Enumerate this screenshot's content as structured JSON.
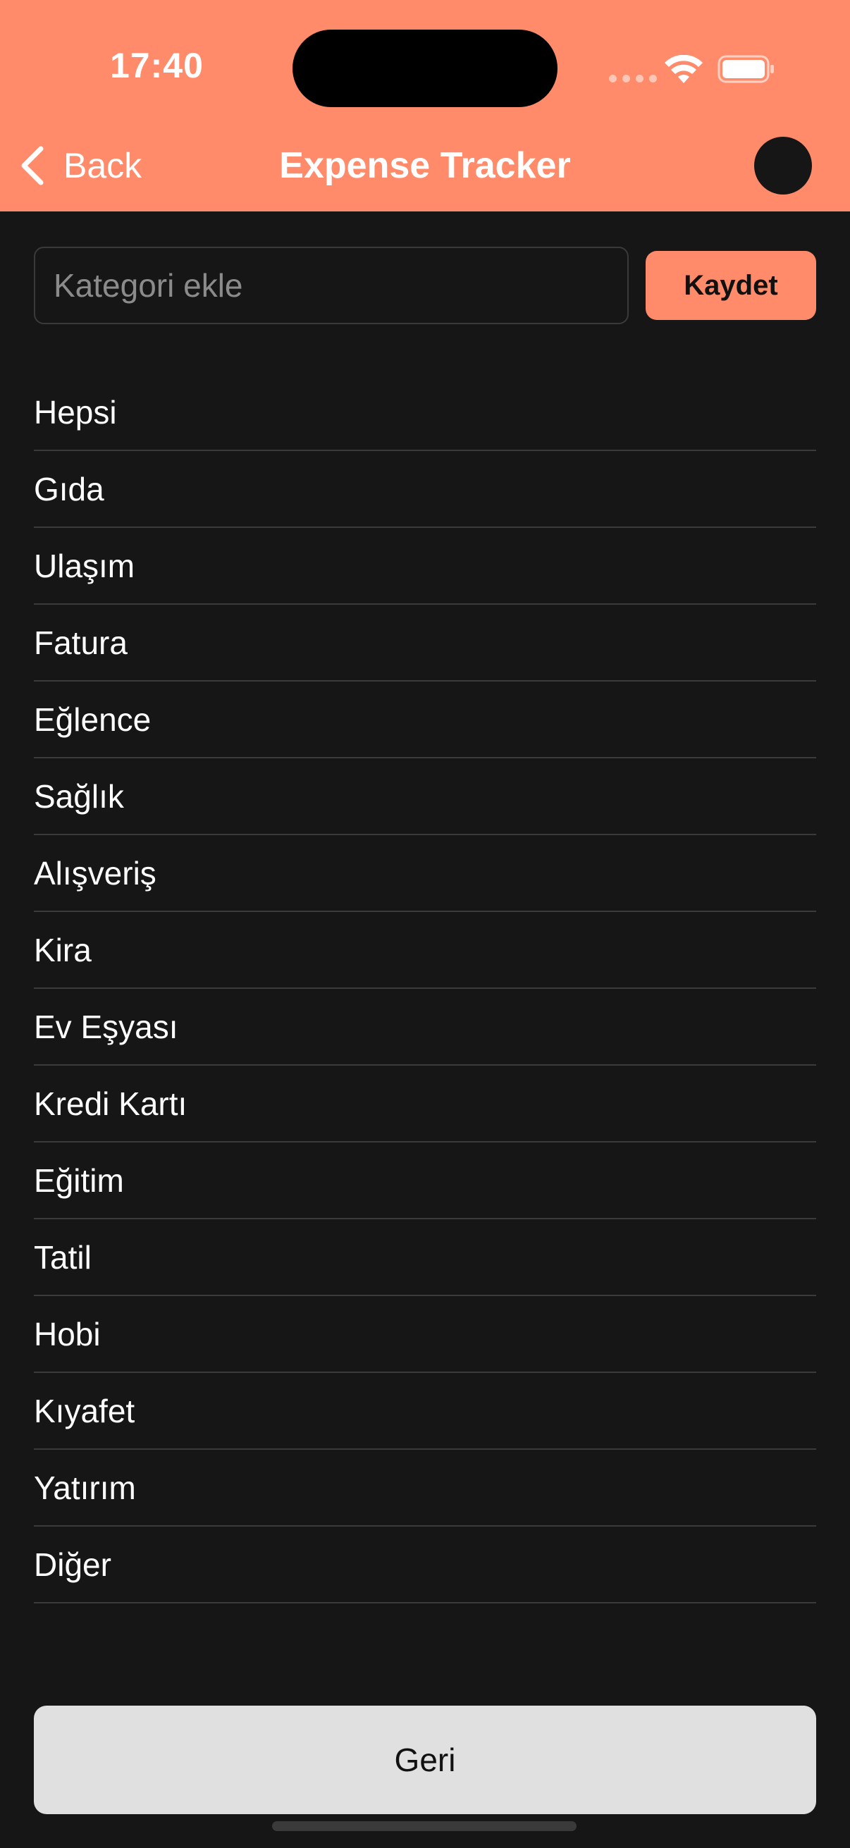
{
  "status_bar": {
    "time": "17:40"
  },
  "nav": {
    "back_label": "Back",
    "title": "Expense Tracker"
  },
  "form": {
    "input_placeholder": "Kategori ekle",
    "input_value": "",
    "save_label": "Kaydet"
  },
  "categories": [
    {
      "label": "Hepsi"
    },
    {
      "label": "Gıda"
    },
    {
      "label": "Ulaşım"
    },
    {
      "label": "Fatura"
    },
    {
      "label": "Eğlence"
    },
    {
      "label": "Sağlık"
    },
    {
      "label": "Alışveriş"
    },
    {
      "label": "Kira"
    },
    {
      "label": "Ev Eşyası"
    },
    {
      "label": "Kredi Kartı"
    },
    {
      "label": "Eğitim"
    },
    {
      "label": "Tatil"
    },
    {
      "label": "Hobi"
    },
    {
      "label": "Kıyafet"
    },
    {
      "label": "Yatırım"
    },
    {
      "label": "Diğer"
    }
  ],
  "footer": {
    "back_label": "Geri"
  },
  "colors": {
    "accent": "#FF8B6B",
    "background": "#161616",
    "divider": "#3B3B3B",
    "bottom_button": "#E0E0E0"
  },
  "icons": {
    "back": "chevron-left-icon",
    "wifi": "wifi-icon",
    "battery": "battery-icon"
  }
}
